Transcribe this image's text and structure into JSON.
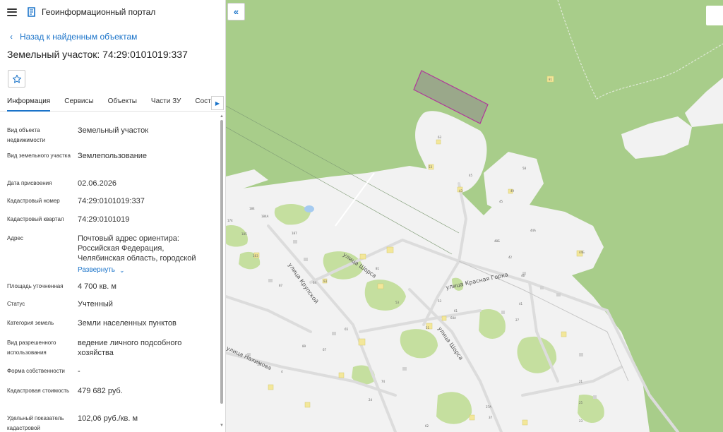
{
  "header": {
    "app_title": "Геоинформационный портал"
  },
  "nav": {
    "back_label": "Назад к найденным объектам"
  },
  "object": {
    "title": "Земельный участок: 74:29:0101019:337"
  },
  "tabs": [
    {
      "label": "Информация",
      "active": true
    },
    {
      "label": "Сервисы",
      "active": false
    },
    {
      "label": "Объекты",
      "active": false
    },
    {
      "label": "Части ЗУ",
      "active": false
    },
    {
      "label": "Состав",
      "active": false
    }
  ],
  "properties": [
    {
      "label": "Вид объекта недвижимости",
      "value": "Земельный участок"
    },
    {
      "label": "Вид земельного участка",
      "value": "Землепользование"
    },
    {
      "label": "Дата присвоения",
      "value": "02.06.2026"
    },
    {
      "label": "Кадастровый номер",
      "value": "74:29:0101019:337"
    },
    {
      "label": "Кадастровый квартал",
      "value": "74:29:0101019"
    },
    {
      "label": "Адрес",
      "value": "Почтовый адрес ориентира: Российская Федерация, Челябинская область, городской",
      "expand_label": "Развернуть"
    },
    {
      "label": "Площадь уточненная",
      "value": "4 700 кв. м"
    },
    {
      "label": "Статус",
      "value": "Учтенный"
    },
    {
      "label": "Категория земель",
      "value": "Земли населенных пунктов"
    },
    {
      "label": "Вид разрешенного использования",
      "value": "ведение личного подсобного хозяйства"
    },
    {
      "label": "Форма собственности",
      "value": "-"
    },
    {
      "label": "Кадастровая стоимость",
      "value": "479 682 руб."
    },
    {
      "label": "Удельный показатель кадастровой",
      "value": "102,06 руб./кв. м"
    }
  ],
  "map": {
    "streets": [
      "улица Шорса",
      "улица Крупской",
      "улица Красная Горка",
      "улица Шорса",
      "улица Нахимова"
    ],
    "house_numbers": [
      "81",
      "63",
      "53",
      "45",
      "43",
      "58",
      "49",
      "45",
      "44А",
      "48Б",
      "42",
      "46",
      "44Б",
      "187",
      "184А",
      "184",
      "185",
      "183",
      "174",
      "87",
      "81",
      "93",
      "64",
      "65",
      "51",
      "61",
      "53",
      "64А",
      "53",
      "41",
      "27",
      "21",
      "89",
      "67",
      "14",
      "4",
      "74",
      "24",
      "62",
      "37А",
      "37",
      "25",
      "23"
    ],
    "colors": {
      "forest": "#a8cd8a",
      "settlement": "#f2f2f2",
      "park": "#c5df9f",
      "building": "#f3e79a",
      "parcel_fill": "#9aa88a",
      "parcel_stroke": "#b0389a",
      "accent": "#1a73c9"
    }
  },
  "icons": {
    "menu": "hamburger-icon",
    "logo": "portal-logo-icon",
    "back": "chevron-left-icon",
    "favorite": "star-icon",
    "tabs_more": "chevron-right-icon",
    "expand": "chevron-down-icon",
    "collapse_panel": "double-chevron-left-icon"
  }
}
